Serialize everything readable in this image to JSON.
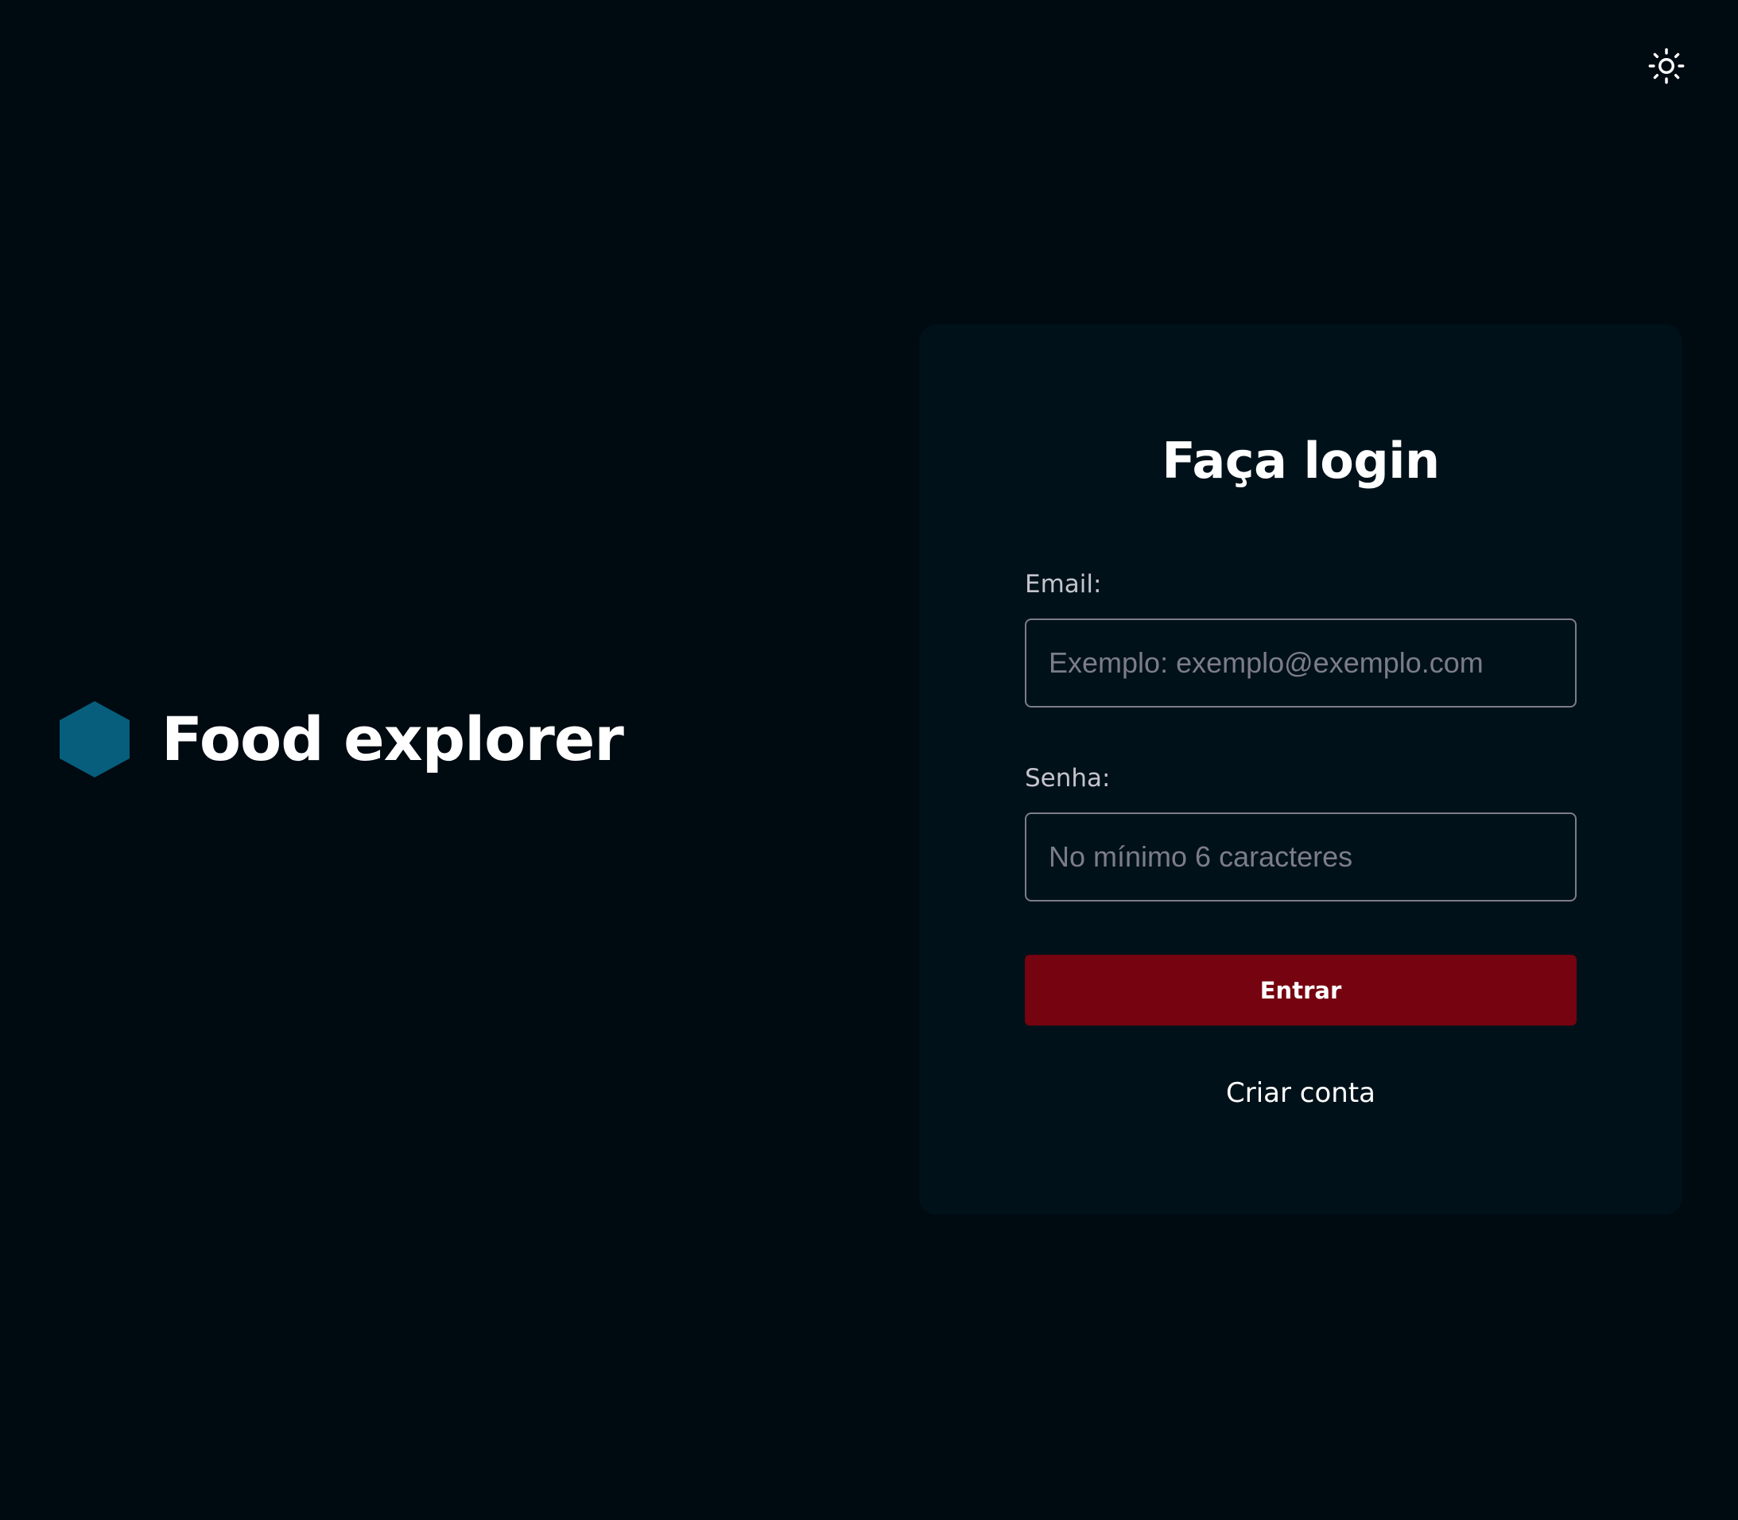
{
  "header": {
    "theme_toggle_icon": "sun-icon"
  },
  "brand": {
    "name": "Food explorer",
    "logo_icon": "hexagon-icon",
    "logo_color": "#065e7c"
  },
  "login": {
    "title": "Faça login",
    "email": {
      "label": "Email:",
      "value": "",
      "placeholder": "Exemplo: exemplo@exemplo.com"
    },
    "password": {
      "label": "Senha:",
      "value": "",
      "placeholder": "No mínimo 6 caracteres"
    },
    "submit_label": "Entrar",
    "create_account_label": "Criar conta"
  },
  "colors": {
    "background": "#000a11",
    "card_background": "#001119",
    "accent": "#750310",
    "input_border": "#7c7c8a",
    "label_text": "#c4c4cc"
  }
}
